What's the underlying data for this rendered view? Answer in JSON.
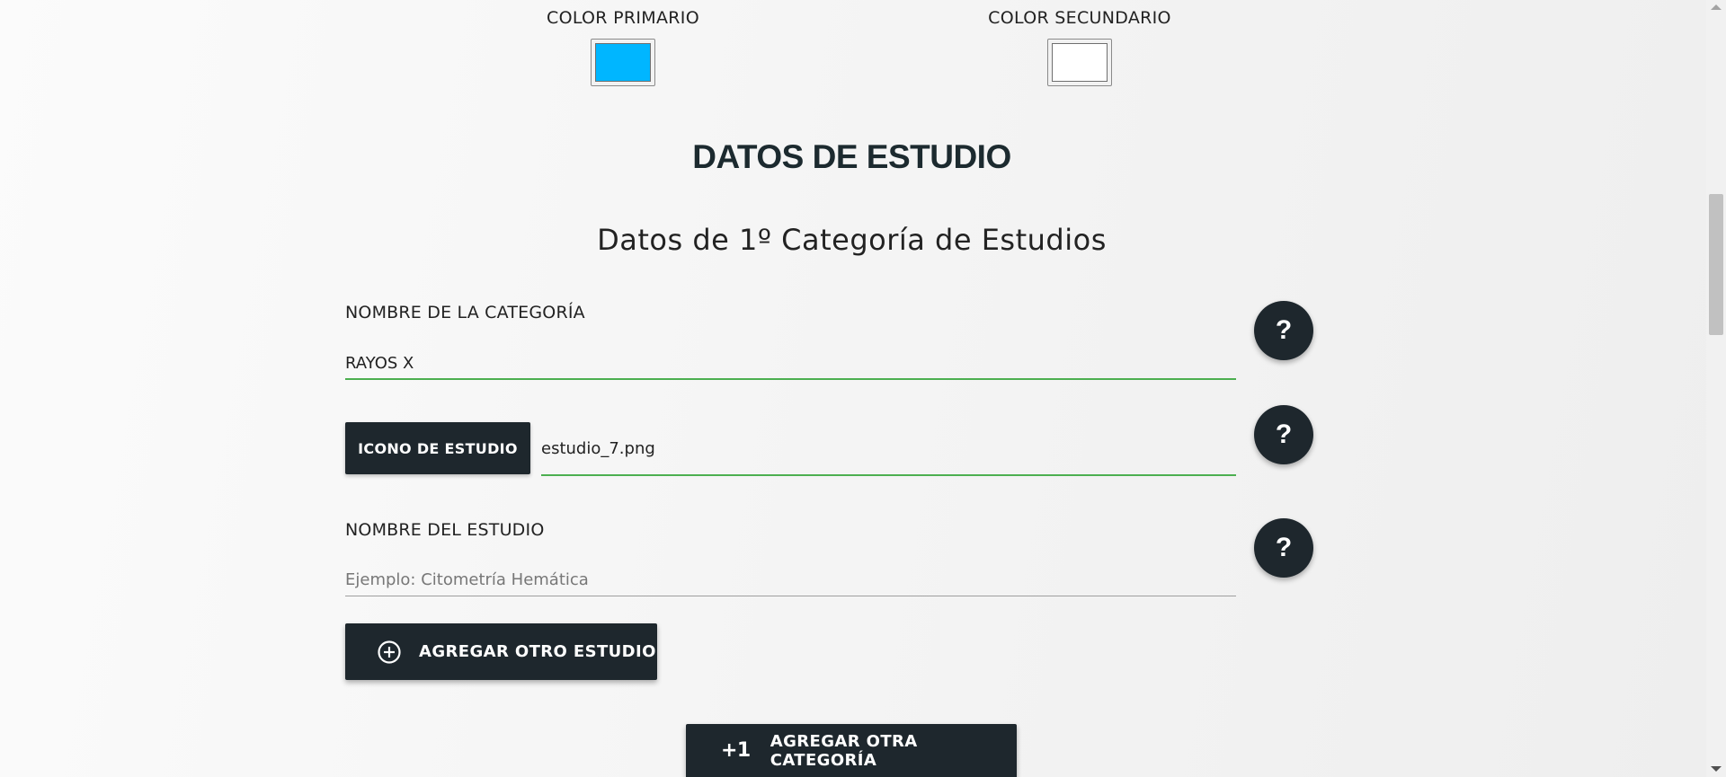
{
  "colors": {
    "primary_label": "COLOR PRIMARIO",
    "primary_value": "#00b6ff",
    "secondary_label": "COLOR SECUNDARIO",
    "secondary_value": "#ffffff"
  },
  "section": {
    "title": "DATOS DE ESTUDIO",
    "subtitle": "Datos de 1º Categoría de Estudios"
  },
  "form": {
    "category_name_label": "NOMBRE DE LA CATEGORÍA",
    "category_name_value": "RAYOS X",
    "study_icon_button": "ICONO DE ESTUDIO",
    "study_icon_file": "estudio_7.png",
    "study_name_label": "NOMBRE DEL ESTUDIO",
    "study_name_value": "",
    "study_name_placeholder": "Ejemplo: Citometría Hemática",
    "help_symbol": "?"
  },
  "actions": {
    "add_study": "AGREGAR OTRO ESTUDIO",
    "add_category_prefix": "+1",
    "add_category": "AGREGAR OTRA CATEGORÍA"
  },
  "icons": {
    "add_study_icon": "plus-circle-icon",
    "help_icon": "question-mark-icon"
  }
}
